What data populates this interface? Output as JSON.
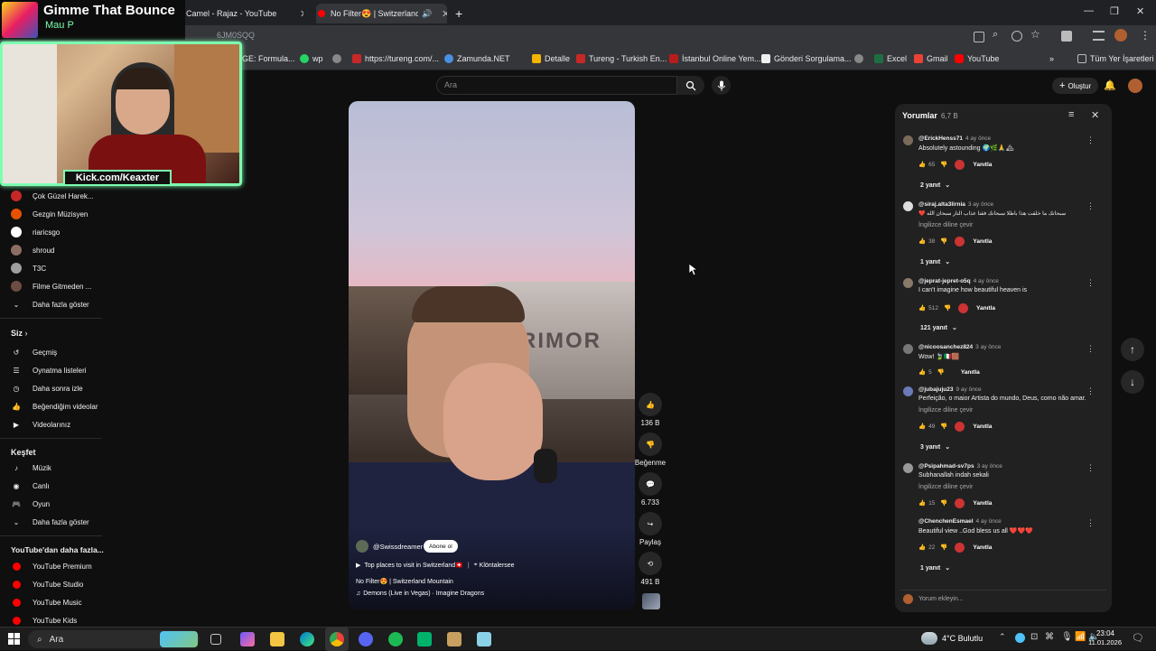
{
  "browser": {
    "tabs": [
      {
        "label": "Camel - Rajaz - YouTube"
      },
      {
        "label": "No Filter😍 | Switzerland M"
      }
    ],
    "bookmarks": [
      {
        "label": "GE: Formula...",
        "color": "#e53935"
      },
      {
        "label": "wp",
        "color": "#25d366"
      },
      {
        "label": "",
        "color": "#888888"
      },
      {
        "label": "https://tureng.com/...",
        "color": "#c62828"
      },
      {
        "label": "Zamunda.NET",
        "color": "#4a90e2"
      },
      {
        "label": "Detalle",
        "color": "#f4b400"
      },
      {
        "label": "Tureng - Turkish En...",
        "color": "#c62828"
      },
      {
        "label": "İstanbul Online Yem...",
        "color": "#b71c1c"
      },
      {
        "label": "Gönderi Sorgulama...",
        "color": "#eeeeee"
      },
      {
        "label": "",
        "color": "#888888"
      },
      {
        "label": "Excel",
        "color": "#1d6f42"
      },
      {
        "label": "Gmail",
        "color": "#ea4335"
      },
      {
        "label": "YouTube",
        "color": "#ff0000"
      }
    ],
    "all_bookmarks": "Tüm Yer İşaretleri",
    "address_text": "6JM0SQQ"
  },
  "stream": {
    "title": "Gimme That Bounce",
    "subtitle": "Mau P",
    "kick_label": "Kick.com/Keaxter"
  },
  "youtube": {
    "search_placeholder": "Ara",
    "create_label": "Oluştur"
  },
  "sidebar": {
    "subscriptions": [
      {
        "label": "Çok Güzel Harek...",
        "color": "#c62828"
      },
      {
        "label": "Gezgin Müzisyen",
        "color": "#e65100"
      },
      {
        "label": "riaricsgo",
        "color": "#ffffff"
      },
      {
        "label": "shroud",
        "color": "#8d6e63"
      },
      {
        "label": "T3C",
        "color": "#9e9e9e"
      },
      {
        "label": "Filme Gitmeden ...",
        "color": "#6d4c41"
      }
    ],
    "show_more_subs": "Daha fazla göster",
    "you_heading": "Siz",
    "you_items": [
      {
        "label": "Geçmiş",
        "icon": "history-icon"
      },
      {
        "label": "Oynatma listeleri",
        "icon": "playlist-icon"
      },
      {
        "label": "Daha sonra izle",
        "icon": "clock-icon"
      },
      {
        "label": "Beğendiğim videolar",
        "icon": "like-icon"
      },
      {
        "label": "Videolarınız",
        "icon": "video-icon"
      }
    ],
    "explore_heading": "Keşfet",
    "explore_items": [
      {
        "label": "Müzik",
        "icon": "music-icon"
      },
      {
        "label": "Canlı",
        "icon": "live-icon"
      },
      {
        "label": "Oyun",
        "icon": "gaming-icon"
      },
      {
        "label": "Daha fazla göster",
        "icon": "chevron-down-icon"
      }
    ],
    "more_heading": "YouTube'dan daha fazla...",
    "more_items": [
      {
        "label": "YouTube Premium"
      },
      {
        "label": "YouTube Studio"
      },
      {
        "label": "YouTube Music"
      },
      {
        "label": "YouTube Kids"
      }
    ]
  },
  "short": {
    "channel": "@Swissdreamer",
    "subscribe_label": "Abone ol",
    "playlist": "Top places to visit in Switzerland🇨🇭",
    "location": "Klöntalersee",
    "title": "No Filter😍 | Switzerland Mountain",
    "music": "Demons (Live in Vegas) · Imagine Dragons",
    "likes": "136 B",
    "dislike_label": "Beğenme",
    "comment_count": "6.733",
    "share_label": "Paylaş",
    "remix_count": "491 B"
  },
  "comments": {
    "title": "Yorumlar",
    "count": "6,7 B",
    "reply_label": "Yanıtla",
    "translate_label": "İngilizce diline çevir",
    "add_placeholder": "Yorum ekleyin...",
    "items": [
      {
        "user": "@ErickHenss71",
        "time": "4 ay önce",
        "text": "Absolutely astounding 🌍🌿🙏🏔",
        "likes": "65",
        "translate": false,
        "replies": "2 yanıt"
      },
      {
        "user": "@siraj.alta3lirnia",
        "time": "3 ay önce",
        "text": "❤️ سبحانك ما خلقت هذا باطلا سبحانك فقنا عذاب النار سبحان الله",
        "likes": "38",
        "translate": true,
        "replies": "1 yanıt"
      },
      {
        "user": "@jeprat-jepret-o5q",
        "time": "4 ay önce",
        "text": "I can't imagine how beautiful heaven is",
        "likes": "512",
        "translate": false,
        "replies": "121 yanıt"
      },
      {
        "user": "@nicoosanchez824",
        "time": "3 ay önce",
        "text": "Wow! 🍃🇮🇹🟫",
        "likes": "5",
        "translate": false,
        "replies": ""
      },
      {
        "user": "@jubajuju23",
        "time": "9 ay önce",
        "text": "Perfeição, o maior Artista do mundo, Deus, como não amar.",
        "likes": "49",
        "translate": true,
        "replies": "3 yanıt"
      },
      {
        "user": "@Psipahmad-sv7ps",
        "time": "3 ay önce",
        "text": "Subhanallah indah sekali",
        "likes": "15",
        "translate": true,
        "replies": ""
      },
      {
        "user": "@ChenchenEsmael",
        "time": "4 ay önce",
        "text": "Beautiful view ..God bless us all ❤️❤️❤️",
        "likes": "22",
        "translate": false,
        "replies": "1 yanıt"
      }
    ]
  },
  "taskbar": {
    "search_label": "Ara",
    "weather": "4°C  Bulutlu",
    "time": "23:04",
    "date": "11.01.2026"
  }
}
